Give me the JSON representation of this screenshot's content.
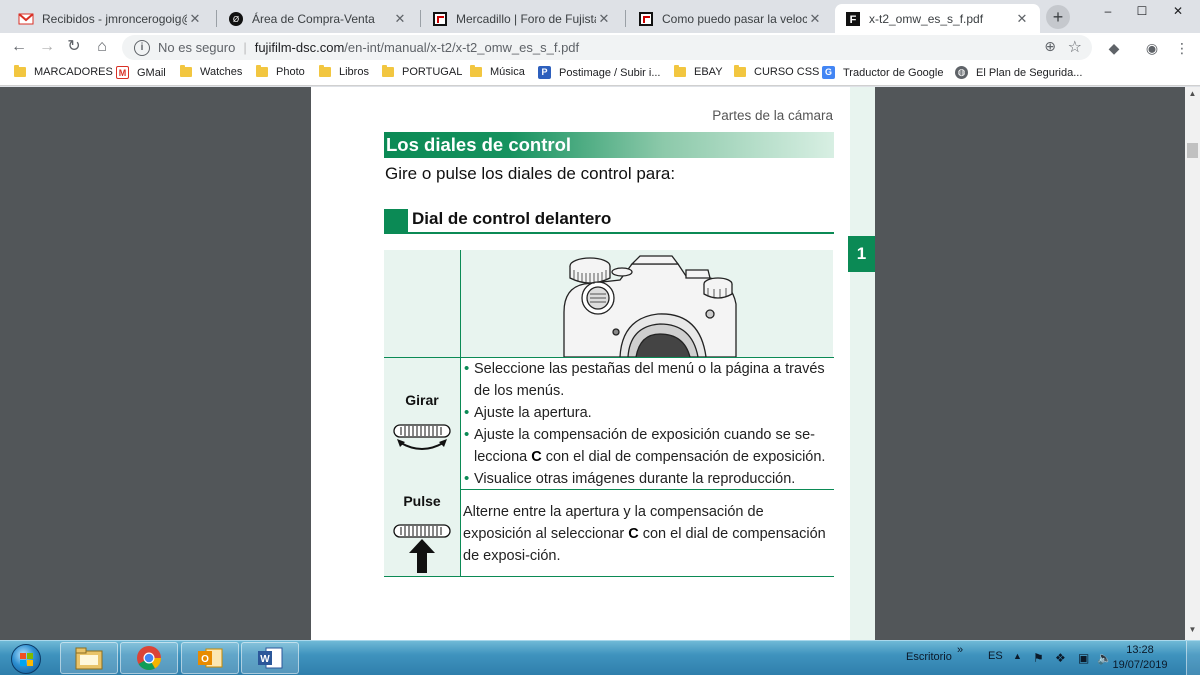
{
  "browser": {
    "tabs": [
      {
        "title": "Recibidos - jmroncerogoig@gm",
        "icon": "gmail-icon"
      },
      {
        "title": "Área de Compra-Venta",
        "icon": "forum-icon"
      },
      {
        "title": "Mercadillo | Foro de Fujistas",
        "icon": "fujistas-icon"
      },
      {
        "title": "Como puedo pasar la velocidad",
        "icon": "fujistas-icon"
      },
      {
        "title": "x-t2_omw_es_s_f.pdf",
        "icon": "fujifilm-icon"
      }
    ],
    "new_tab_label": "+",
    "window_controls": {
      "minimize": "–",
      "maximize": "☐",
      "close": "✕"
    },
    "nav": {
      "back": "←",
      "forward": "→",
      "reload": "↻",
      "home": "⌂"
    },
    "address": {
      "security_label": "No es seguro",
      "host": "fujifilm-dsc.com",
      "path": "/en-int/manual/x-t2/x-t2_omw_es_s_f.pdf"
    },
    "bookmarks": [
      {
        "label": "MARCADORES",
        "icon": "folder"
      },
      {
        "label": "GMail",
        "icon": "gmail"
      },
      {
        "label": "Watches",
        "icon": "folder"
      },
      {
        "label": "Photo",
        "icon": "folder"
      },
      {
        "label": "Libros",
        "icon": "folder"
      },
      {
        "label": "PORTUGAL",
        "icon": "folder"
      },
      {
        "label": "Música",
        "icon": "folder"
      },
      {
        "label": "Postimage / Subir i...",
        "icon": "postimage"
      },
      {
        "label": "EBAY",
        "icon": "folder"
      },
      {
        "label": "CURSO CSS",
        "icon": "folder"
      },
      {
        "label": "Traductor de Google",
        "icon": "translate"
      },
      {
        "label": "El Plan de Segurida...",
        "icon": "globe"
      }
    ]
  },
  "document": {
    "header_label": "Partes de la cámara",
    "chapter_number": "1",
    "section_title": "Los diales de control",
    "intro": "Gire o pulse los diales de control para:",
    "subsection_title": "Dial de control delantero",
    "rows": {
      "rotate": {
        "label": "Girar",
        "bullets": [
          "Seleccione las pestañas del menú o la página a través de los menús.",
          "Ajuste la apertura.",
          "Ajuste la compensación de exposición cuando se se-",
          "Visualice otras imágenes durante la reproducción."
        ],
        "bullet3_mark": "C",
        "bullet3_cont": " con el dial de compensación de exposición.",
        "bullet3_prefix": "lecciona "
      },
      "press": {
        "label": "Pulse",
        "text_before": "Alterne entre la apertura y la compensación de exposición al seleccionar ",
        "mark": "C",
        "text_after": " con el dial de compensación de exposi-ción."
      }
    },
    "accent_color": "#0b8a55"
  },
  "taskbar": {
    "apps": [
      "file-explorer",
      "chrome",
      "outlook",
      "word"
    ],
    "desktop_label": "Escritorio",
    "chevron": "»",
    "language": "ES",
    "tray_up": "▲",
    "time": "13:28",
    "date": "19/07/2019"
  }
}
